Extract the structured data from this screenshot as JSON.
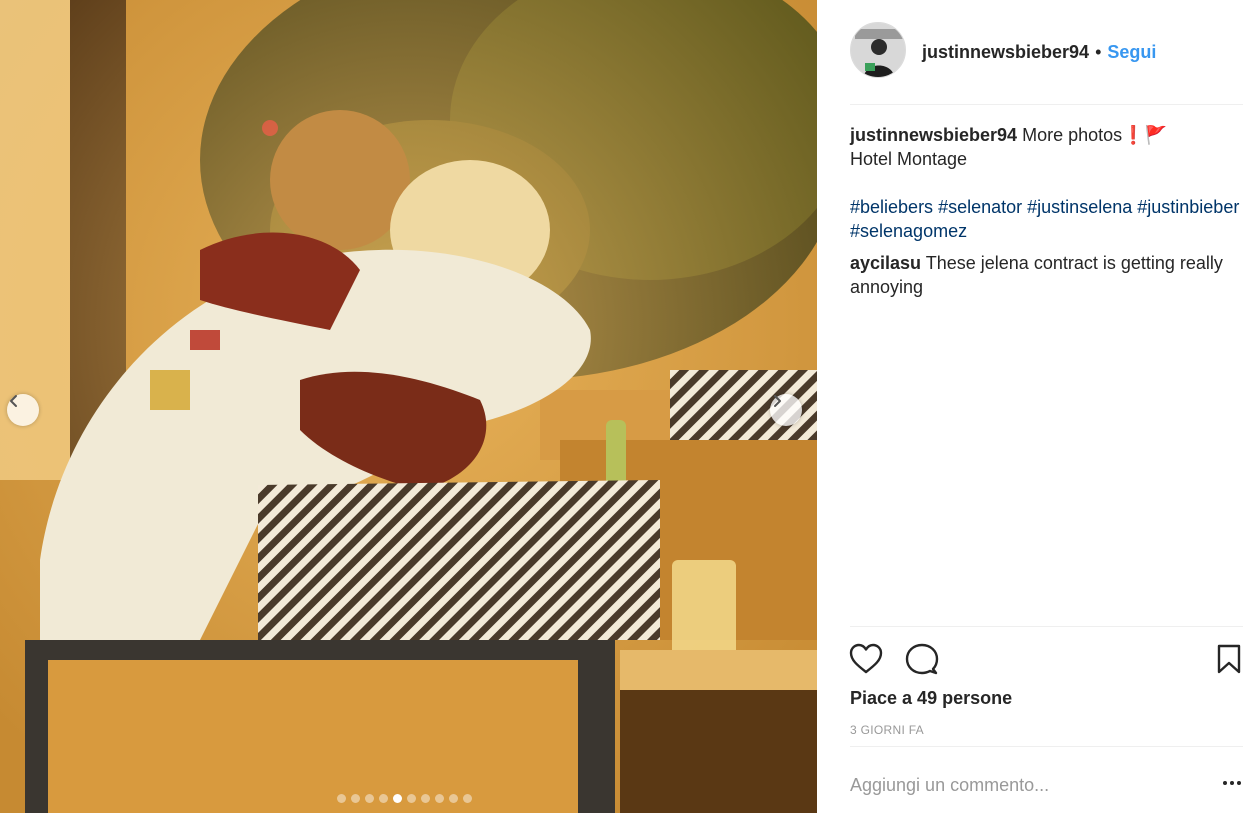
{
  "post": {
    "username": "justinnewsbieber94",
    "separator": "•",
    "follow_label": "Segui",
    "caption_text": "More photos",
    "caption_emoji": "❗🚩",
    "location_line": "Hotel Montage",
    "hashtags": [
      "#beliebers",
      "#selenator",
      "#justinselena",
      "#justinbieber",
      "#selenagomez"
    ]
  },
  "comments": [
    {
      "username": "aycilasu",
      "text": "These jelena contract is getting really annoying"
    }
  ],
  "likes": {
    "label": "Piace a 49 persone"
  },
  "timestamp": "3 GIORNI FA",
  "add_comment": {
    "placeholder": "Aggiungi un commento..."
  },
  "carousel": {
    "total": 10,
    "active_index": 4
  },
  "icons": {
    "prev": "chevron-left-icon",
    "next": "chevron-right-icon",
    "like": "heart-icon",
    "comment": "comment-bubble-icon",
    "save": "bookmark-icon",
    "more": "ellipsis-icon"
  },
  "colors": {
    "link": "#3897f0",
    "hashtag": "#003569",
    "muted": "#999999"
  }
}
